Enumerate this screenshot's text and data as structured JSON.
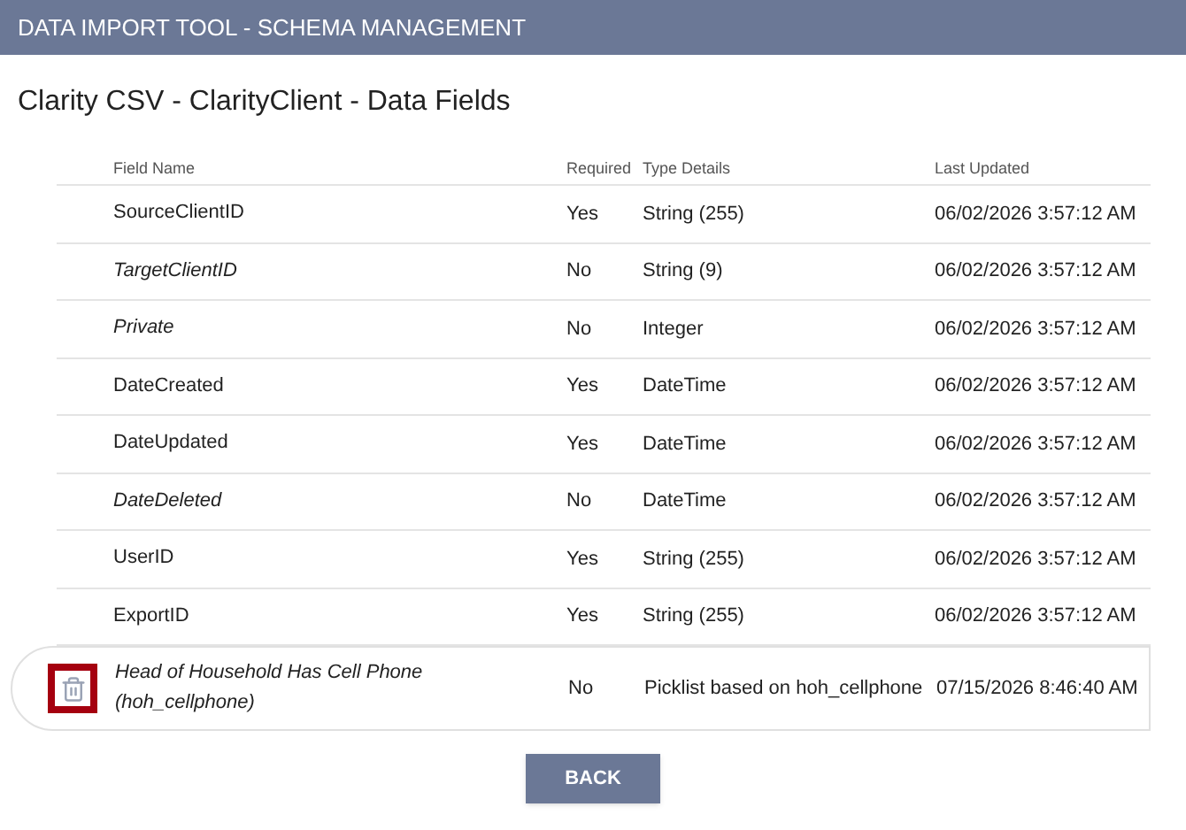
{
  "header": {
    "title": "DATA IMPORT TOOL - SCHEMA MANAGEMENT"
  },
  "page_title": "Clarity CSV - ClarityClient - Data Fields",
  "table": {
    "columns": [
      "Field Name",
      "Required",
      "Type Details",
      "Last Updated"
    ],
    "rows": [
      {
        "field_name": "SourceClientID",
        "required": "Yes",
        "type_details": "String (255)",
        "last_updated": "06/02/2026 3:57:12 AM",
        "optional": false,
        "hovered": false
      },
      {
        "field_name": "TargetClientID",
        "required": "No",
        "type_details": "String (9)",
        "last_updated": "06/02/2026 3:57:12 AM",
        "optional": true,
        "hovered": false
      },
      {
        "field_name": "Private",
        "required": "No",
        "type_details": "Integer",
        "last_updated": "06/02/2026 3:57:12 AM",
        "optional": true,
        "hovered": false
      },
      {
        "field_name": "DateCreated",
        "required": "Yes",
        "type_details": "DateTime",
        "last_updated": "06/02/2026 3:57:12 AM",
        "optional": false,
        "hovered": false
      },
      {
        "field_name": "DateUpdated",
        "required": "Yes",
        "type_details": "DateTime",
        "last_updated": "06/02/2026 3:57:12 AM",
        "optional": false,
        "hovered": false
      },
      {
        "field_name": "DateDeleted",
        "required": "No",
        "type_details": "DateTime",
        "last_updated": "06/02/2026 3:57:12 AM",
        "optional": true,
        "hovered": false
      },
      {
        "field_name": "UserID",
        "required": "Yes",
        "type_details": "String (255)",
        "last_updated": "06/02/2026 3:57:12 AM",
        "optional": false,
        "hovered": false
      },
      {
        "field_name": "ExportID",
        "required": "Yes",
        "type_details": "String (255)",
        "last_updated": "06/02/2026 3:57:12 AM",
        "optional": false,
        "hovered": false
      },
      {
        "field_name": "Head of Household Has Cell Phone (hoh_cellphone)",
        "required": "No",
        "type_details": "Picklist based on hoh_cellphone",
        "last_updated": "07/15/2026 8:46:40 AM",
        "optional": true,
        "hovered": true
      }
    ]
  },
  "back_button": "BACK"
}
